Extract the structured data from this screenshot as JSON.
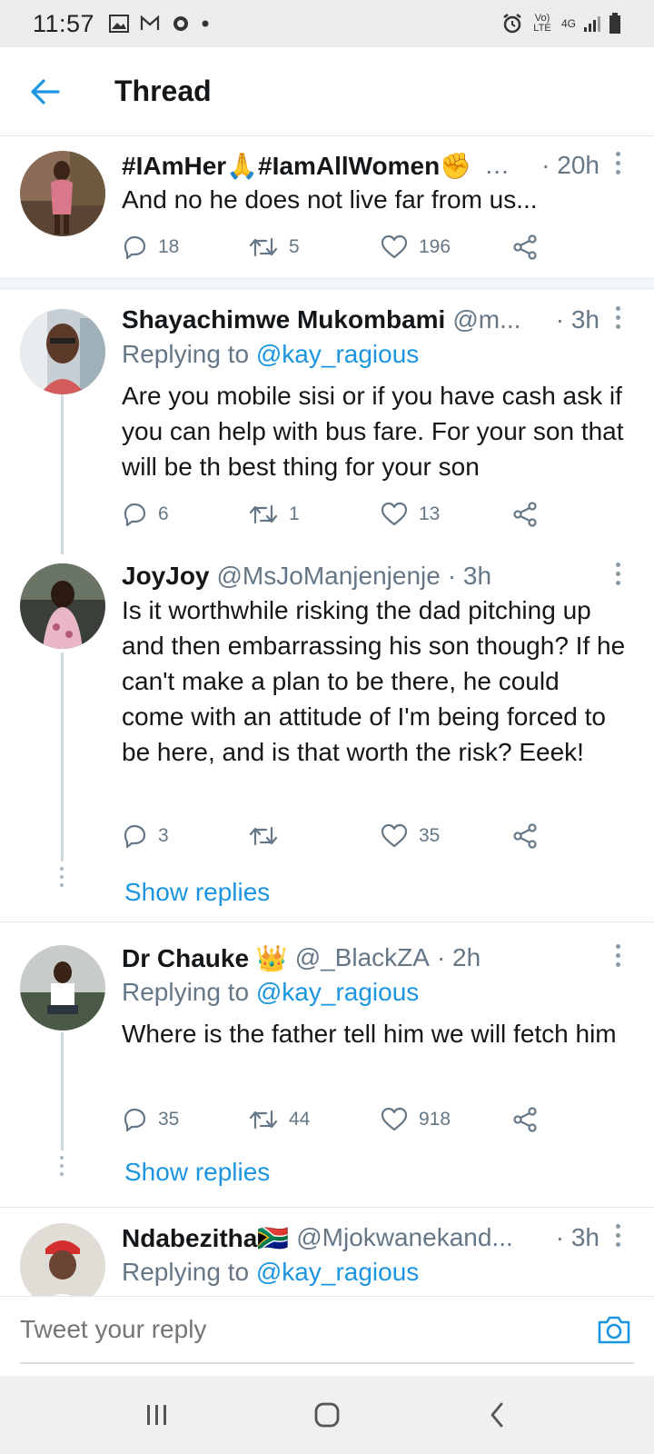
{
  "status_bar": {
    "time": "11:57",
    "network_label": "Vo) LTE",
    "network_type": "4G"
  },
  "header": {
    "title": "Thread"
  },
  "tweets": [
    {
      "name": "#IAmHer🙏#IamAllWomen✊",
      "handle": "…",
      "time": "· 20h",
      "reply_to_prefix": "",
      "reply_to": "",
      "text": "And no he does not live far from us...",
      "replies": "18",
      "retweets": "5",
      "likes": "196"
    },
    {
      "name": "Shayachimwe Mukombami",
      "handle": "@m...",
      "time": "· 3h",
      "reply_to_prefix": "Replying to",
      "reply_to": "@kay_ragious",
      "text": "Are you mobile sisi or if you have cash ask if you can help with bus fare. For your son that will be th best thing for your son",
      "replies": "6",
      "retweets": "1",
      "likes": "13"
    },
    {
      "name": "JoyJoy",
      "handle": "@MsJoManjenjenje",
      "time": "· 3h",
      "reply_to_prefix": "",
      "reply_to": "",
      "text": "Is it worthwhile risking the dad pitching up and then embarrassing his son though? If he can't make a plan to be there, he could come with an attitude of I'm being forced to be here, and is that worth the risk? Eeek!",
      "replies": "3",
      "retweets": "",
      "likes": "35",
      "show_replies": "Show replies"
    },
    {
      "name": "Dr Chauke 👑",
      "handle": "@_BlackZA",
      "time": "· 2h",
      "reply_to_prefix": "Replying to",
      "reply_to": "@kay_ragious",
      "text": "Where is the father tell him we will fetch him",
      "replies": "35",
      "retweets": "44",
      "likes": "918",
      "show_replies": "Show replies"
    },
    {
      "name": "Ndabezitha🇿🇦",
      "handle": "@Mjokwanekand...",
      "time": "· 3h",
      "reply_to_prefix": "Replying to",
      "reply_to": "@kay_ragious"
    }
  ],
  "composer": {
    "placeholder": "Tweet your reply"
  },
  "colors": {
    "accent": "#1b95e0",
    "secondary_text": "#657786",
    "primary_text": "#14171a"
  },
  "icons": {
    "back": "arrow-left-icon",
    "reply": "reply-icon",
    "retweet": "retweet-icon",
    "like": "heart-icon",
    "share": "share-icon",
    "more": "more-vertical-icon",
    "camera": "camera-icon"
  }
}
